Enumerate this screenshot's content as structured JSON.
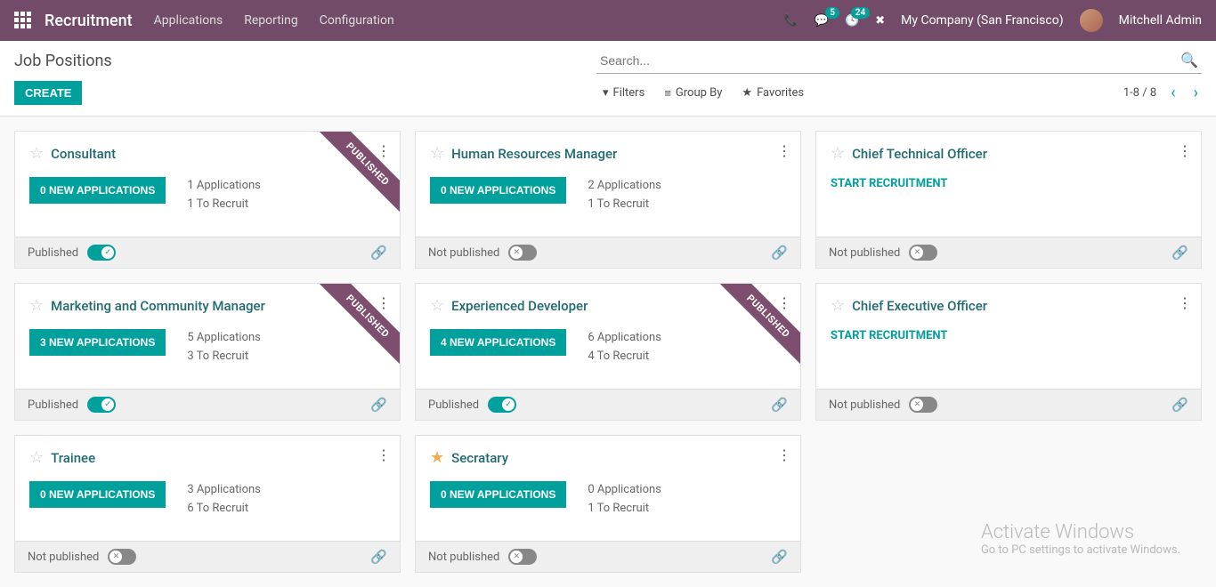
{
  "nav": {
    "brand": "Recruitment",
    "links": [
      "Applications",
      "Reporting",
      "Configuration"
    ],
    "badge_msg": "5",
    "badge_activity": "24",
    "company": "My Company (San Francisco)",
    "user": "Mitchell Admin"
  },
  "control": {
    "breadcrumb": "Job Positions",
    "search_placeholder": "Search...",
    "create": "CREATE",
    "filters": "Filters",
    "groupby": "Group By",
    "favorites": "Favorites",
    "pager": "1-8 / 8"
  },
  "labels": {
    "published_ribbon": "PUBLISHED",
    "published": "Published",
    "not_published": "Not published",
    "start_recruitment": "START RECRUITMENT"
  },
  "cards": [
    {
      "title": "Consultant",
      "fav": false,
      "apps_btn": "0 NEW APPLICATIONS",
      "line1": "1 Applications",
      "line2": "1 To Recruit",
      "published": true,
      "ribbon": true
    },
    {
      "title": "Human Resources Manager",
      "fav": false,
      "apps_btn": "0 NEW APPLICATIONS",
      "line1": "2 Applications",
      "line2": "1 To Recruit",
      "published": false,
      "ribbon": false
    },
    {
      "title": "Chief Technical Officer",
      "fav": false,
      "start": true,
      "published": false,
      "ribbon": false
    },
    {
      "title": "Marketing and Community Manager",
      "fav": false,
      "apps_btn": "3 NEW APPLICATIONS",
      "line1": "5 Applications",
      "line2": "3 To Recruit",
      "published": true,
      "ribbon": true
    },
    {
      "title": "Experienced Developer",
      "fav": false,
      "apps_btn": "4 NEW APPLICATIONS",
      "line1": "6 Applications",
      "line2": "4 To Recruit",
      "published": true,
      "ribbon": true
    },
    {
      "title": "Chief Executive Officer",
      "fav": false,
      "start": true,
      "published": false,
      "ribbon": false
    },
    {
      "title": "Trainee",
      "fav": false,
      "apps_btn": "0 NEW APPLICATIONS",
      "line1": "3 Applications",
      "line2": "6 To Recruit",
      "published": false,
      "ribbon": false
    },
    {
      "title": "Secratary",
      "fav": true,
      "apps_btn": "0 NEW APPLICATIONS",
      "line1": "0 Applications",
      "line2": "1 To Recruit",
      "published": false,
      "ribbon": false
    }
  ],
  "watermark": {
    "line1": "Activate Windows",
    "line2": "Go to PC settings to activate Windows."
  }
}
